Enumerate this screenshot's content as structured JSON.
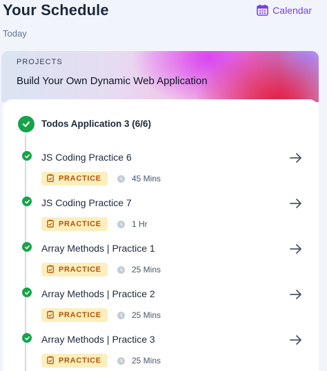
{
  "header": {
    "title": "Your Schedule",
    "subtitle": "Today",
    "calendar_label": "Calendar"
  },
  "banner": {
    "kicker": "PROJECTS",
    "title": "Build Your Own Dynamic Web Application"
  },
  "module": {
    "title": "Todos Application 3 (6/6)"
  },
  "items": [
    {
      "title": "JS Coding Practice 6",
      "badge": "PRACTICE",
      "duration": "45 Mins"
    },
    {
      "title": "JS Coding Practice 7",
      "badge": "PRACTICE",
      "duration": "1 Hr"
    },
    {
      "title": "Array Methods | Practice 1",
      "badge": "PRACTICE",
      "duration": "25 Mins"
    },
    {
      "title": "Array Methods | Practice 2",
      "badge": "PRACTICE",
      "duration": "25 Mins"
    },
    {
      "title": "Array Methods | Practice 3",
      "badge": "PRACTICE",
      "duration": "25 Mins"
    }
  ],
  "colors": {
    "accent": "#7c3aed",
    "success": "#16a34a",
    "badge_bg": "#fcefbd",
    "badge_text": "#b45309"
  },
  "icons": {
    "calendar": "calendar-icon",
    "check": "check-icon",
    "arrow": "arrow-right-icon",
    "clipboard": "clipboard-icon",
    "clock": "clock-icon"
  }
}
